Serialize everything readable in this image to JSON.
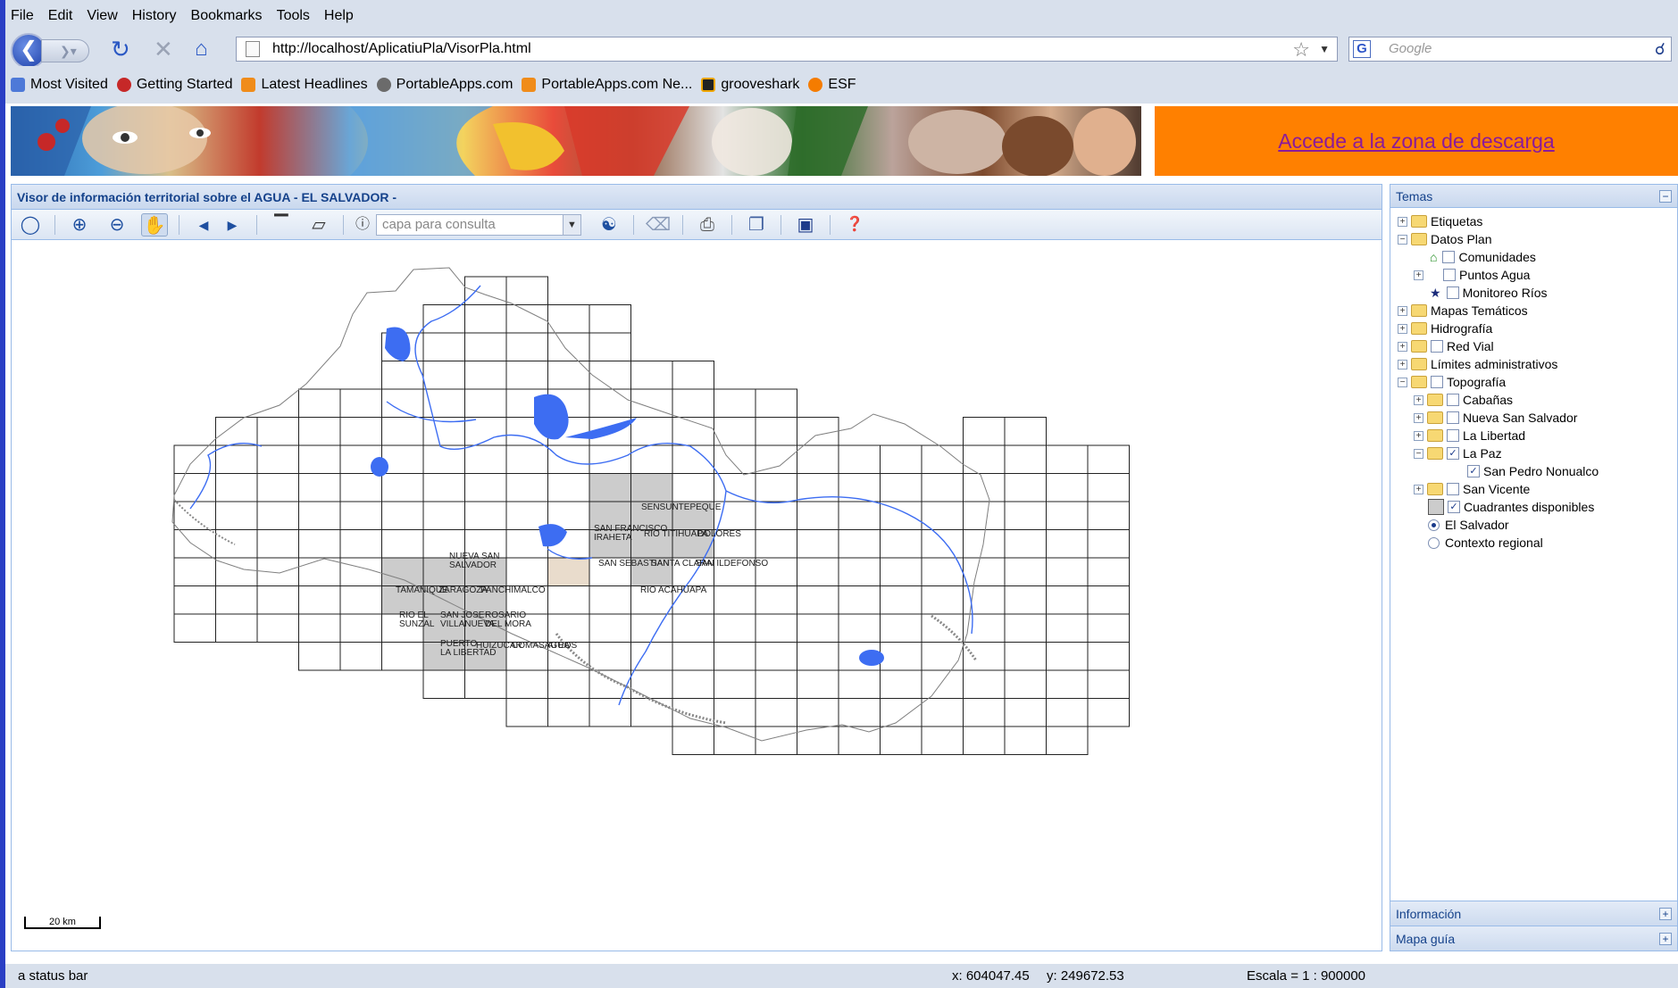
{
  "menu": [
    "File",
    "Edit",
    "View",
    "History",
    "Bookmarks",
    "Tools",
    "Help"
  ],
  "nav": {
    "url": "http://localhost/AplicatiuPla/VisorPla.html",
    "search_placeholder": "Google"
  },
  "bookmarks": [
    "Most Visited",
    "Getting Started",
    "Latest Headlines",
    "PortableApps.com",
    "PortableApps.com Ne...",
    "grooveshark",
    "ESF"
  ],
  "page": {
    "download_link": "Accede a la zona de descarga",
    "map_panel_title": "Visor de información territorial sobre el AGUA - EL SALVADOR -",
    "query_layer_placeholder": "capa para consulta",
    "scale_label": "20 km"
  },
  "map": {
    "labels": [
      {
        "text": "SENSUNTEPEQUE"
      },
      {
        "text": "SAN FRANCISCO\nIRAHETA"
      },
      {
        "text": "RIO TITIHUAPA"
      },
      {
        "text": "DOLORES"
      },
      {
        "text": "NUEVA SAN\nSALVADOR"
      },
      {
        "text": "SAN SEBASTIAN"
      },
      {
        "text": "SANTA CLARA"
      },
      {
        "text": "SAN ILDEFONSO"
      },
      {
        "text": "TAMANIQUE"
      },
      {
        "text": "ZARAGOZA"
      },
      {
        "text": "PANCHIMALCO"
      },
      {
        "text": "RIO ACAHUAPA"
      },
      {
        "text": "RIO EL\nSUNZAL"
      },
      {
        "text": "SAN JOSE\nVILLANUEVA"
      },
      {
        "text": "ROSARIO\nDEL MORA"
      },
      {
        "text": "PUERTO\nLA LIBERTAD"
      },
      {
        "text": "HUIZUCAR"
      },
      {
        "text": "COMASAGUA"
      },
      {
        "text": "ATEOS"
      }
    ]
  },
  "tree": {
    "title": "Temas",
    "nodes": [
      "Etiquetas",
      "Datos Plan",
      "Comunidades",
      "Puntos Agua",
      "Monitoreo Ríos",
      "Mapas Temáticos",
      "Hidrografía",
      "Red Vial",
      "Límites administrativos",
      "Topografía",
      "Cabañas",
      "Nueva San Salvador",
      "La Libertad",
      "La Paz",
      "San Pedro Nonualco",
      "San Vicente",
      "Cuadrantes disponibles",
      "El Salvador",
      "Contexto regional"
    ],
    "info": "Información",
    "guide": "Mapa guía"
  },
  "status": {
    "text": "a status bar",
    "x_coord": "x: 604047.45",
    "y_coord": "y: 249672.53",
    "scale": "Escala = 1 : 900000"
  },
  "colors": {
    "orange": "#ff8000",
    "link": "#8b1a9a",
    "water": "#3d6df2",
    "grid_fill": "#cccccc"
  }
}
